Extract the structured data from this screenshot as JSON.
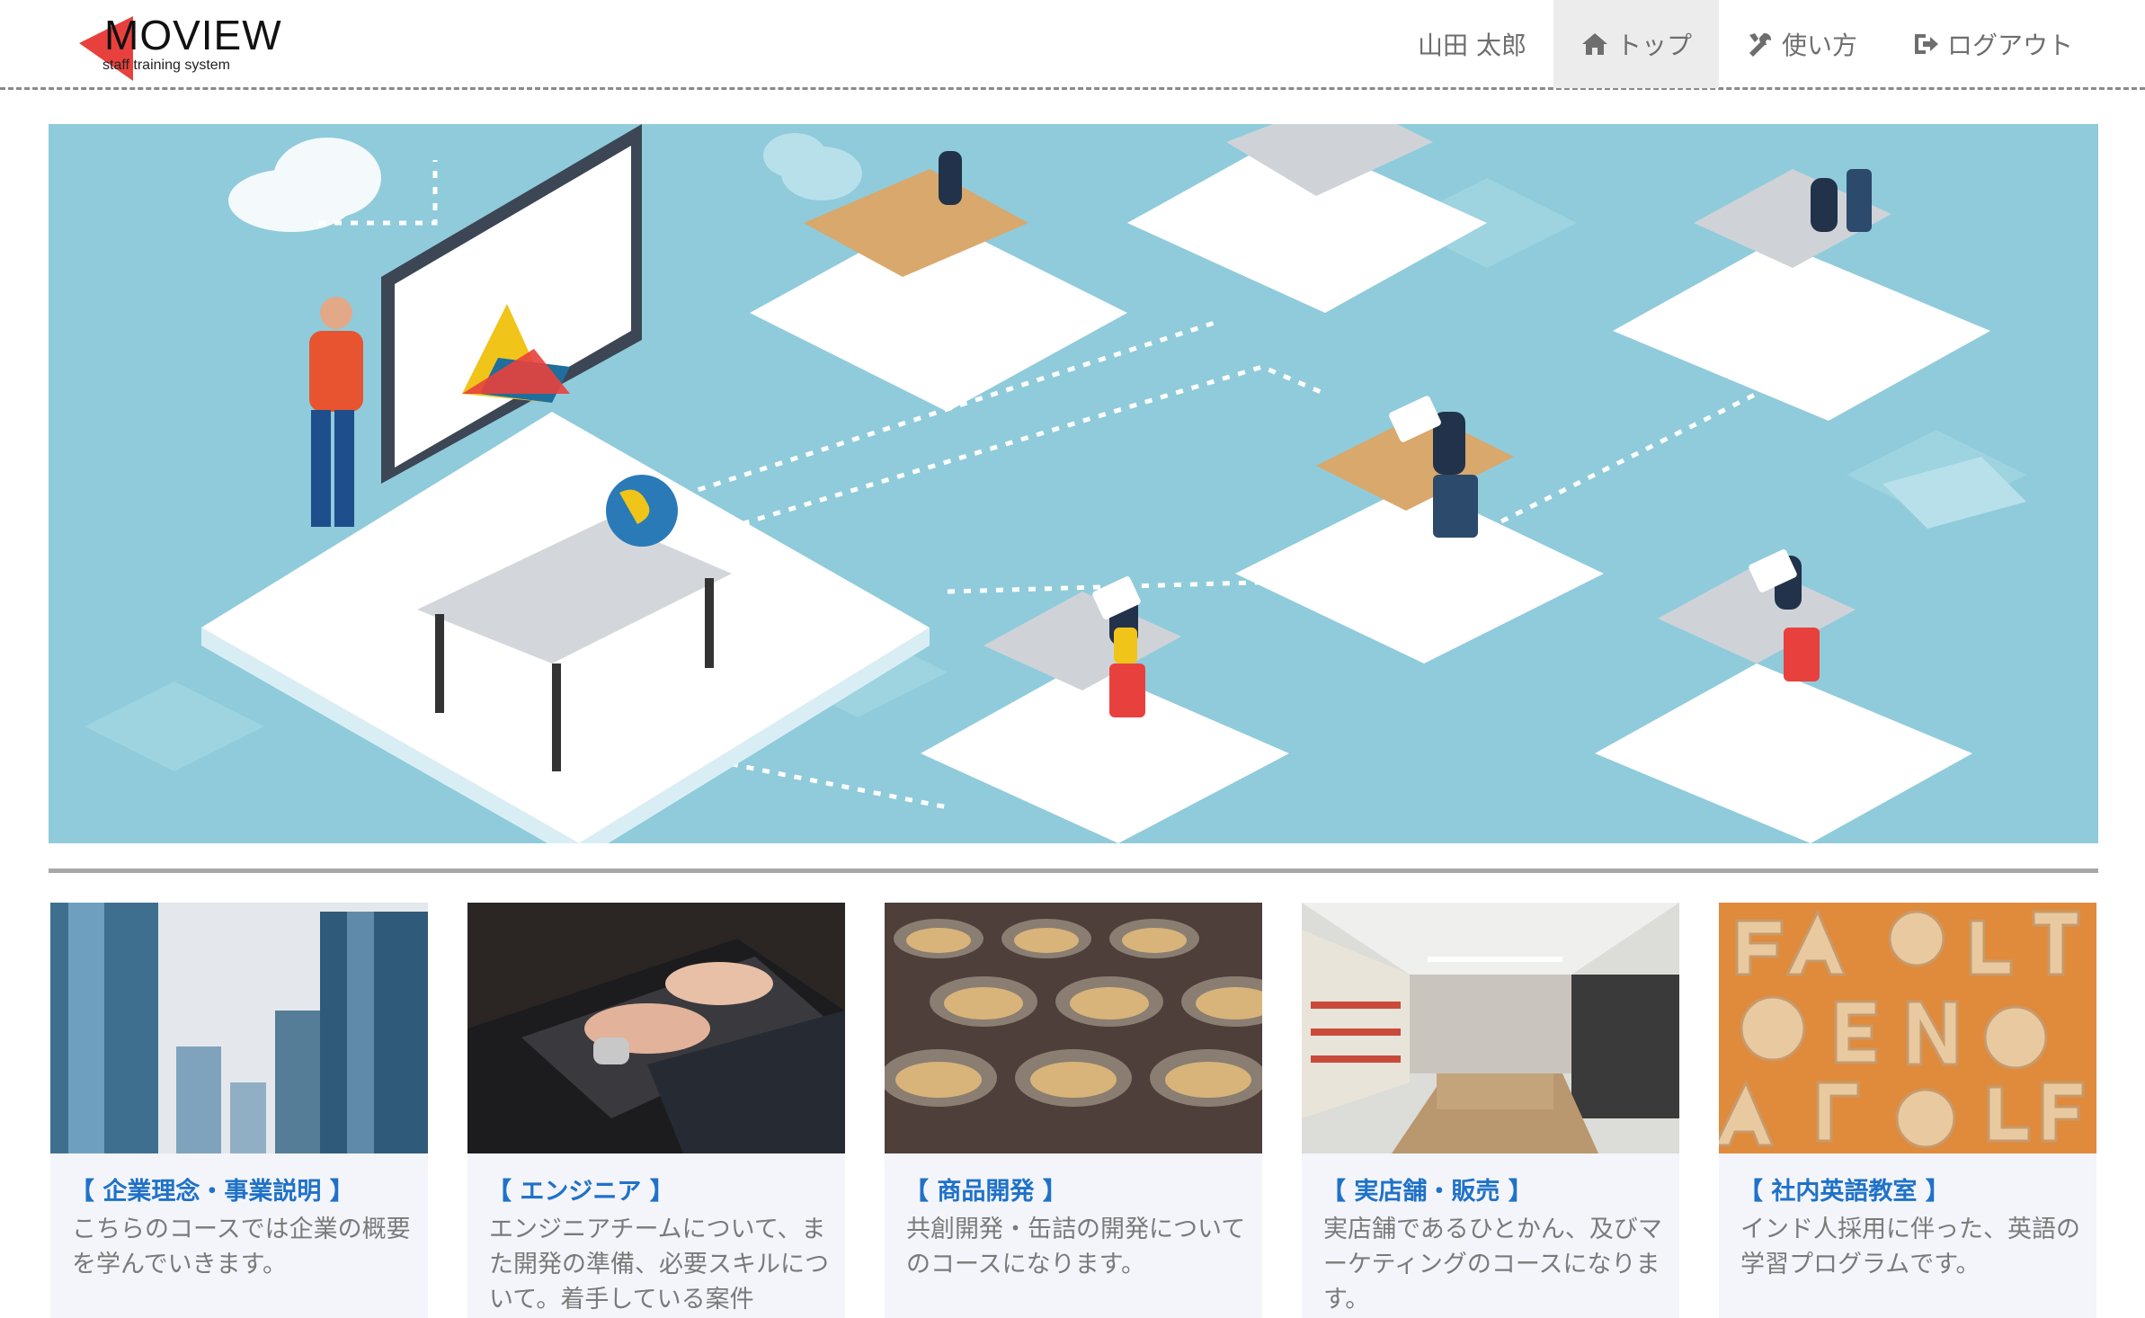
{
  "brand": {
    "logo_text": "MOVIEW",
    "logo_subtitle": "staff training system",
    "accent": "#e8413d"
  },
  "nav": {
    "user_name": "山田 太郎",
    "items": [
      {
        "label": "トップ",
        "icon": "home-icon",
        "active": true
      },
      {
        "label": "使い方",
        "icon": "tools-icon",
        "active": false
      },
      {
        "label": "ログアウト",
        "icon": "logout-icon",
        "active": false
      }
    ]
  },
  "hero": {
    "image": "isometric-online-classroom-illustration",
    "background": "#8fcbdb"
  },
  "courses": [
    {
      "title": "【 企業理念・事業説明 】",
      "description": "こちらのコースでは企業の概要を学んでいきます。",
      "image": "office-buildings-photo"
    },
    {
      "title": "【 エンジニア 】",
      "description": "エンジニアチームについて、また開発の準備、必要スキルについて。着手している案件",
      "image": "laptop-typing-photo"
    },
    {
      "title": "【 商品開発 】",
      "description": "共創開発・缶詰の開発についてのコースになります。",
      "image": "canned-food-photo"
    },
    {
      "title": "【 実店舗・販売 】",
      "description": "実店舗であるひとかん、及びマーケティングのコースになります。",
      "image": "store-interior-photo"
    },
    {
      "title": "【 社内英語教室 】",
      "description": "インド人採用に伴った、英語の学習プログラムです。",
      "image": "alphabet-biscuits-photo"
    }
  ],
  "colors": {
    "link": "#1f72c8",
    "muted_text": "#7a7a7a",
    "card_bg": "#f4f5fb"
  }
}
